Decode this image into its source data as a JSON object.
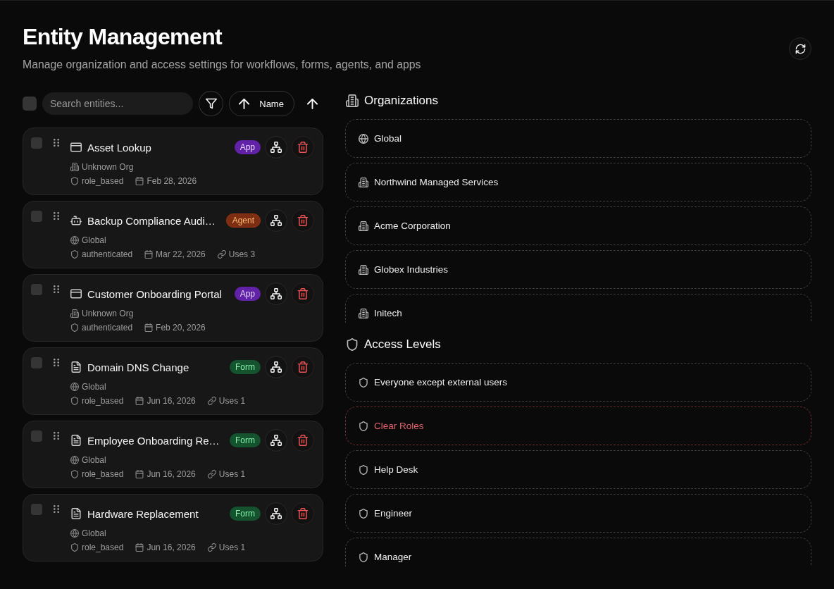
{
  "header": {
    "title": "Entity Management",
    "subtitle": "Manage organization and access settings for workflows, forms, agents, and apps"
  },
  "toolbar": {
    "select_all": {
      "checked": false
    },
    "search": {
      "placeholder": "Search entities..."
    },
    "sort": {
      "label": "Name",
      "ascending": true
    }
  },
  "entities": [
    {
      "kind": "app",
      "name": "Asset Lookup",
      "badge": "App",
      "checked": false,
      "org": {
        "kind": "org",
        "name": "Unknown Org"
      },
      "access": "role_based",
      "date": "Feb 28, 2026"
    },
    {
      "kind": "agent",
      "name": "Backup Compliance Audi…",
      "badge": "Agent",
      "checked": false,
      "org": {
        "kind": "global",
        "name": "Global"
      },
      "access": "authenticated",
      "date": "Mar 22, 2026",
      "uses": "Uses 3"
    },
    {
      "kind": "app",
      "name": "Customer Onboarding Portal",
      "badge": "App",
      "checked": false,
      "org": {
        "kind": "org",
        "name": "Unknown Org"
      },
      "access": "authenticated",
      "date": "Feb 20, 2026"
    },
    {
      "kind": "form",
      "name": "Domain DNS Change",
      "badge": "Form",
      "checked": false,
      "org": {
        "kind": "global",
        "name": "Global"
      },
      "access": "role_based",
      "date": "Jun 16, 2026",
      "uses": "Uses 1"
    },
    {
      "kind": "form",
      "name": "Employee Onboarding Re…",
      "badge": "Form",
      "checked": false,
      "org": {
        "kind": "global",
        "name": "Global"
      },
      "access": "role_based",
      "date": "Jun 16, 2026",
      "uses": "Uses 1"
    },
    {
      "kind": "form",
      "name": "Hardware Replacement",
      "badge": "Form",
      "checked": false,
      "org": {
        "kind": "global",
        "name": "Global"
      },
      "access": "role_based",
      "date": "Jun 16, 2026",
      "uses": "Uses 1"
    }
  ],
  "organizations": {
    "title": "Organizations",
    "items": [
      {
        "kind": "global",
        "name": "Global"
      },
      {
        "kind": "org",
        "name": "Northwind Managed Services"
      },
      {
        "kind": "org",
        "name": "Acme Corporation"
      },
      {
        "kind": "org",
        "name": "Globex Industries"
      },
      {
        "kind": "org",
        "name": "Initech"
      }
    ]
  },
  "access_levels": {
    "title": "Access Levels",
    "items": [
      {
        "name": "Everyone except external users",
        "danger": false
      },
      {
        "name": "Clear Roles",
        "danger": true
      },
      {
        "name": "Help Desk",
        "danger": false
      },
      {
        "name": "Engineer",
        "danger": false
      },
      {
        "name": "Manager",
        "danger": false
      }
    ]
  }
}
